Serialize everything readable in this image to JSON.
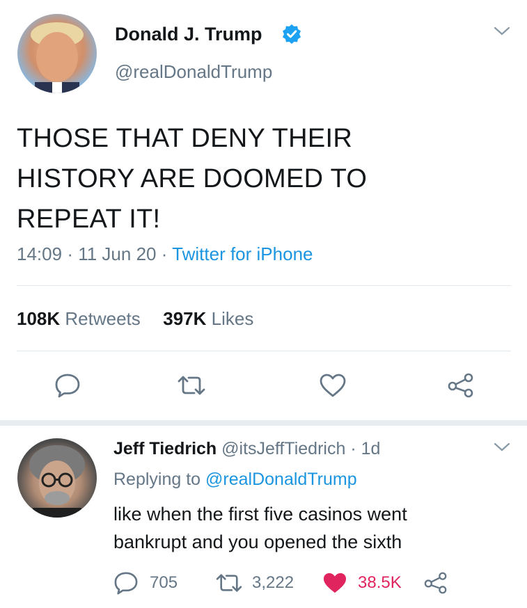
{
  "tweet": {
    "author_name": "Donald J. Trump",
    "author_handle": "@realDonaldTrump",
    "text_lines": [
      "THOSE THAT DENY THEIR",
      "HISTORY ARE DOOMED TO",
      "REPEAT IT!"
    ],
    "time": "14:09",
    "date": "11 Jun 20",
    "separator": "·",
    "source": "Twitter for iPhone",
    "retweets_count": "108K",
    "retweets_label": "Retweets",
    "likes_count": "397K",
    "likes_label": "Likes"
  },
  "reply": {
    "author_name": "Jeff Tiedrich",
    "author_handle": "@itsJeffTiedrich",
    "separator": "·",
    "age": "1d",
    "replying_prefix": "Replying to",
    "replying_to": "@realDonaldTrump",
    "text_lines": [
      "like when the first five casinos went",
      "bankrupt and you opened the sixth"
    ],
    "reply_count": "705",
    "retweet_count": "3,222",
    "like_count": "38.5K"
  },
  "colors": {
    "verified": "#1da1f2",
    "link": "#1b95e0",
    "liked": "#e0245e",
    "muted": "#657786"
  },
  "icons": [
    "verified-badge-icon",
    "chevron-down-icon",
    "reply-icon",
    "retweet-icon",
    "like-icon",
    "share-icon"
  ]
}
